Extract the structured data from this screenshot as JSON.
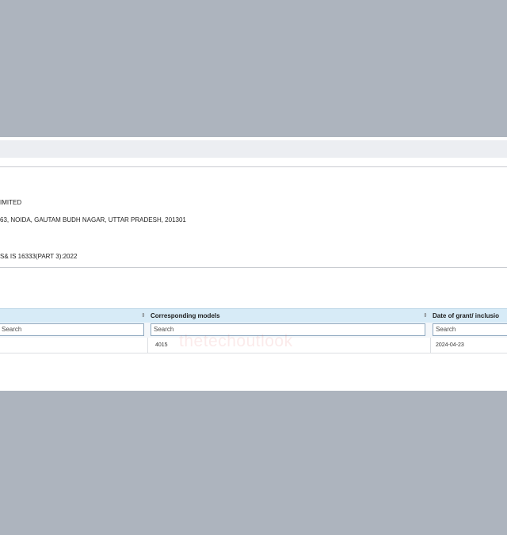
{
  "info": {
    "company": "IMITED",
    "address": "63, NOIDA, GAUTAM BUDH NAGAR, UTTAR PRADESH, 201301",
    "standard": "S& IS 16333(PART 3):2022"
  },
  "table": {
    "columns": [
      {
        "label": ""
      },
      {
        "label": "Corresponding models"
      },
      {
        "label": "Date of grant/ inclusio"
      }
    ],
    "sort_icon": "⇕",
    "search_placeholder": "Search",
    "rows": [
      {
        "cells": [
          "",
          "4015",
          "2024-04-23"
        ]
      }
    ]
  },
  "watermark": {
    "text": "thetechoutlook"
  }
}
